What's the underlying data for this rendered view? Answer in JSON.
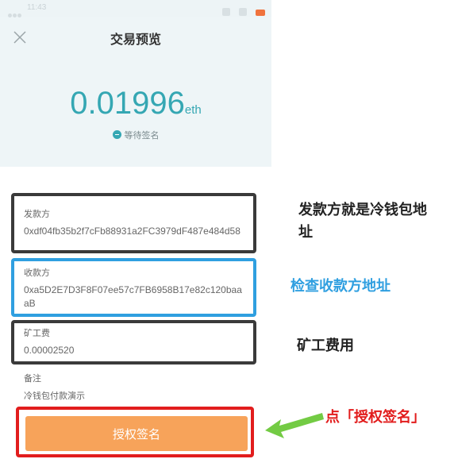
{
  "status_bar": {
    "time": "11:43"
  },
  "header": {
    "title": "交易预览",
    "close_icon": "close-icon"
  },
  "transaction": {
    "amount": "0.01996",
    "unit": "eth",
    "status": "等待签名"
  },
  "details": {
    "from_label": "发款方",
    "from_value": "0xdf04fb35b2f7cFb88931a2FC3979dF487e484d58",
    "to_label": "收款方",
    "to_value": "0xa5D2E7D3F8F07ee57c7FB6958B17e82c120baaaB",
    "fee_label": "矿工费",
    "fee_value": "0.00002520",
    "memo_label": "备注",
    "memo_value": "冷钱包付款演示"
  },
  "sign_button": {
    "label": "授权签名"
  },
  "annotations": {
    "from_note": "发款方就是冷钱包地址",
    "to_note": "检查收款方地址",
    "fee_note": "矿工费用",
    "sign_note": "点「授权签名」"
  },
  "colors": {
    "accent": "#35a7b3",
    "button": "#f7a35a",
    "highlight_red": "#e21d1d",
    "highlight_blue": "#2f9fe0",
    "arrow_green": "#6cc83a"
  }
}
